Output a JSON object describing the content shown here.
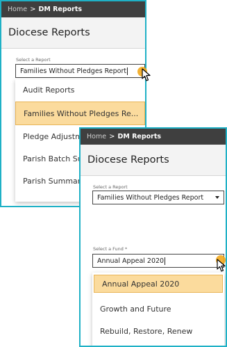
{
  "colors": {
    "accent": "#1fb1c6",
    "header_bar": "#3f3f3f",
    "highlight": "#fbdb9d",
    "click_marker": "#f2a81d"
  },
  "back_panel": {
    "breadcrumb": {
      "home": "Home",
      "separator": ">",
      "current": "DM Reports"
    },
    "title": "Diocese Reports",
    "report_label": "Select a Report",
    "report_value": "Families Without Pledges Report",
    "report_options": [
      "Audit Reports",
      "Families Without Pledges Re...",
      "Pledge Adjustm",
      "Parish Batch Su",
      "Parish Summar"
    ]
  },
  "front_panel": {
    "breadcrumb": {
      "home": "Home",
      "separator": ">",
      "current": "DM Reports"
    },
    "title": "Diocese Reports",
    "report_label": "Select a Report",
    "report_value": "Families Without Pledges Report",
    "fund_label": "Select a Fund *",
    "fund_value": "Annual Appeal 2020",
    "fund_options": [
      "Annual Appeal 2020",
      "Growth and Future",
      "Rebuild, Restore, Renew"
    ]
  },
  "icons": {
    "caret": "chevron-down-icon",
    "pointer": "mouse-pointer-icon",
    "click": "click-indicator-icon"
  }
}
